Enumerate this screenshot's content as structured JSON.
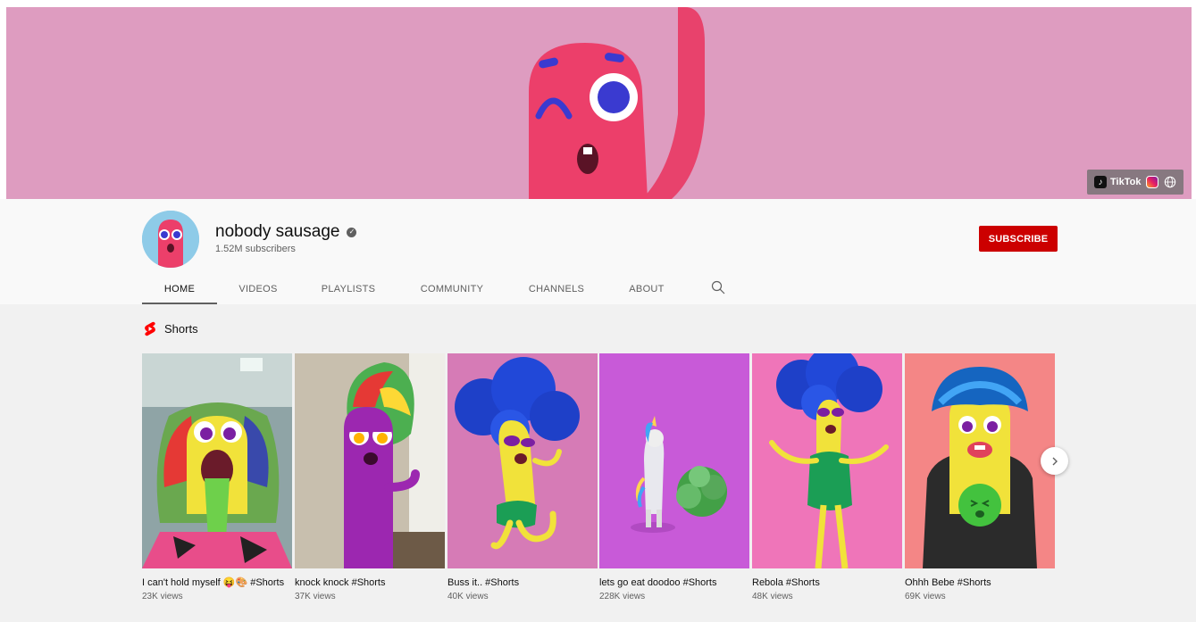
{
  "banner": {
    "links": [
      {
        "label": "TikTok",
        "icon": "tiktok-icon"
      },
      {
        "label": "",
        "icon": "instagram-icon"
      },
      {
        "label": "",
        "icon": "globe-icon"
      }
    ],
    "color": "#de9cc0"
  },
  "channel": {
    "name": "nobody sausage",
    "verified_glyph": "✓",
    "subscribers": "1.52M subscribers",
    "subscribe_label": "SUBSCRIBE"
  },
  "tabs": [
    {
      "label": "HOME",
      "active": true
    },
    {
      "label": "VIDEOS",
      "active": false
    },
    {
      "label": "PLAYLISTS",
      "active": false
    },
    {
      "label": "COMMUNITY",
      "active": false
    },
    {
      "label": "CHANNELS",
      "active": false
    },
    {
      "label": "ABOUT",
      "active": false
    }
  ],
  "shorts": {
    "section_title": "Shorts",
    "items": [
      {
        "title": "I can't hold myself 😝🎨 #Shorts",
        "views": "23K views"
      },
      {
        "title": "knock knock #Shorts",
        "views": "37K views"
      },
      {
        "title": "Buss it.. #Shorts",
        "views": "40K views"
      },
      {
        "title": "lets go eat doodoo #Shorts",
        "views": "228K views"
      },
      {
        "title": "Rebola #Shorts",
        "views": "48K views"
      },
      {
        "title": "Ohhh Bebe #Shorts",
        "views": "69K views"
      }
    ]
  },
  "colors": {
    "accent_red": "#cc0000",
    "text_primary": "#0f0f0f",
    "text_secondary": "#606060"
  }
}
